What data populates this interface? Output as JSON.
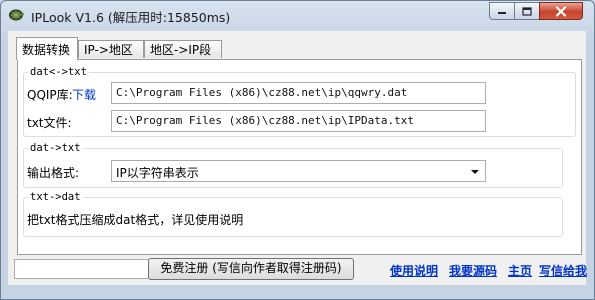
{
  "window": {
    "title": "IPLook V1.6 (解压用时:15850ms)",
    "app_icon": "tortoise-icon",
    "controls": {
      "minimize": "minimize-icon",
      "maximize": "maximize-icon",
      "close": "close-icon"
    }
  },
  "tabs": [
    {
      "label": "数据转换",
      "active": true
    },
    {
      "label": "IP->地区",
      "active": false
    },
    {
      "label": "地区->IP段",
      "active": false
    }
  ],
  "dat_txt_group": {
    "title": "dat<->txt",
    "qqip_label": "QQIP库:",
    "download_link": "下载",
    "qqip_path": "C:\\Program Files (x86)\\cz88.net\\ip\\qqwry.dat",
    "txt_label": "txt文件:",
    "txt_path": "C:\\Program Files (x86)\\cz88.net\\ip\\IPData.txt"
  },
  "dat_to_txt_group": {
    "title": "dat->txt",
    "format_label": "输出格式:",
    "format_value": "IP以字符串表示"
  },
  "txt_to_dat_group": {
    "title": "txt->dat",
    "description": "把txt格式压缩成dat格式，详见使用说明"
  },
  "bottom": {
    "register_button": "免费注册 (写信向作者取得注册码)",
    "links": [
      "使用说明",
      "我要源码",
      "主页",
      "写信给我"
    ]
  },
  "colors": {
    "link": "#0033cc",
    "close_button": "#c8442d",
    "frame": "#c6d3e3"
  }
}
